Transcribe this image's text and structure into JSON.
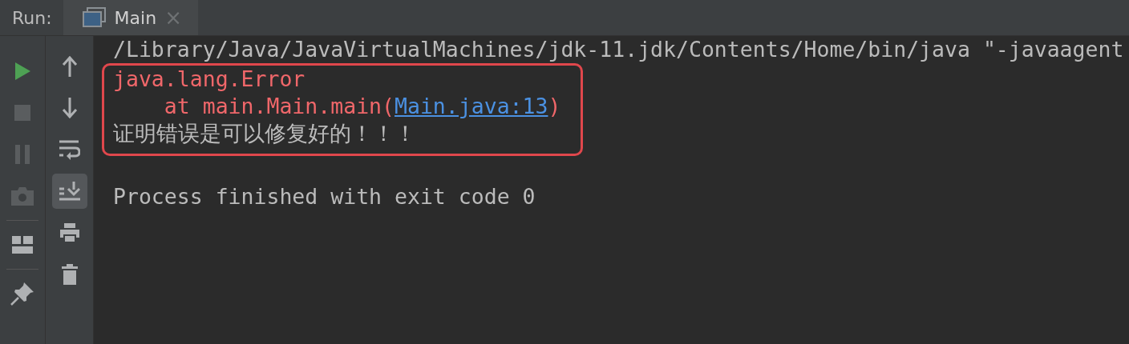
{
  "run_bar": {
    "label": "Run:",
    "tabs": [
      {
        "label": "Main",
        "close": "×",
        "selected": true
      }
    ]
  },
  "left_toolbar": [
    {
      "kind": "run",
      "disabled": false
    },
    {
      "kind": "stop",
      "disabled": true
    },
    {
      "kind": "pause",
      "disabled": true
    },
    {
      "kind": "camera",
      "disabled": true
    },
    {
      "kind": "separator"
    },
    {
      "kind": "layout",
      "disabled": false
    },
    {
      "kind": "separator"
    },
    {
      "kind": "pin",
      "disabled": false
    }
  ],
  "console_toolbar": [
    {
      "kind": "up",
      "selected": false
    },
    {
      "kind": "down",
      "selected": false
    },
    {
      "kind": "soft-wrap",
      "selected": false
    },
    {
      "kind": "scroll-to-end",
      "selected": true
    },
    {
      "kind": "print",
      "selected": false
    },
    {
      "kind": "trash",
      "selected": false
    }
  ],
  "console": {
    "blocks": [
      {
        "highlighted": false,
        "lines": [
          [
            {
              "kind": "normal",
              "text": "/Library/Java/JavaVirtualMachines/jdk-11.jdk/Contents/Home/bin/java \"-javaagent"
            }
          ]
        ]
      },
      {
        "highlighted": true,
        "lines": [
          [
            {
              "kind": "error",
              "text": "java.lang.Error"
            }
          ],
          [
            {
              "kind": "error",
              "text": "    at main.Main.main("
            },
            {
              "kind": "link",
              "text": "Main.java:13"
            },
            {
              "kind": "error",
              "text": ")"
            }
          ],
          [
            {
              "kind": "normal",
              "text": "证明错误是可以修复好的！！！"
            }
          ]
        ]
      },
      {
        "highlighted": false,
        "lines": [
          [
            {
              "kind": "normal",
              "text": "Process finished with exit code 0"
            }
          ]
        ]
      }
    ]
  }
}
